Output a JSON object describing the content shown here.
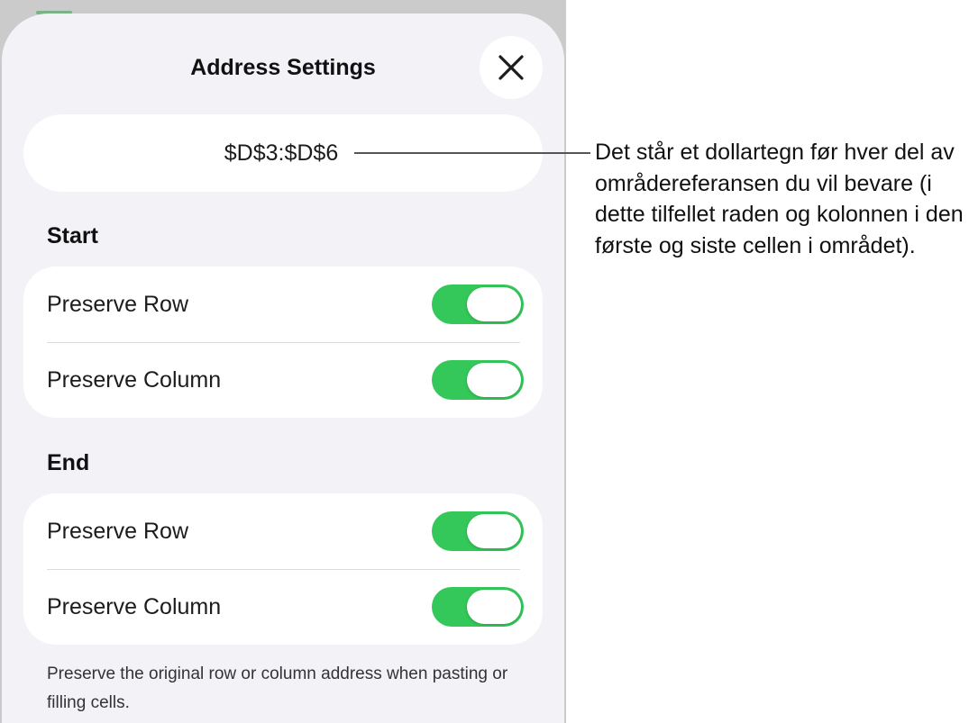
{
  "sheet": {
    "title": "Address Settings",
    "close_icon": "close-icon",
    "address_value": "$D$3:$D$6"
  },
  "start": {
    "heading": "Start",
    "preserve_row": {
      "label": "Preserve Row",
      "on": true
    },
    "preserve_column": {
      "label": "Preserve Column",
      "on": true
    }
  },
  "end": {
    "heading": "End",
    "preserve_row": {
      "label": "Preserve Row",
      "on": true
    },
    "preserve_column": {
      "label": "Preserve Column",
      "on": true
    }
  },
  "footnote": "Preserve the original row or column address when pasting or filling cells.",
  "callout": "Det står et dollartegn før hver del av områdereferansen du vil bevare (i dette tilfellet raden og kolonnen i den første og siste cellen i området).",
  "colors": {
    "toggle_on": "#34c759",
    "sheet_background": "#f2f2f7",
    "backdrop": "#cbcbcb"
  }
}
